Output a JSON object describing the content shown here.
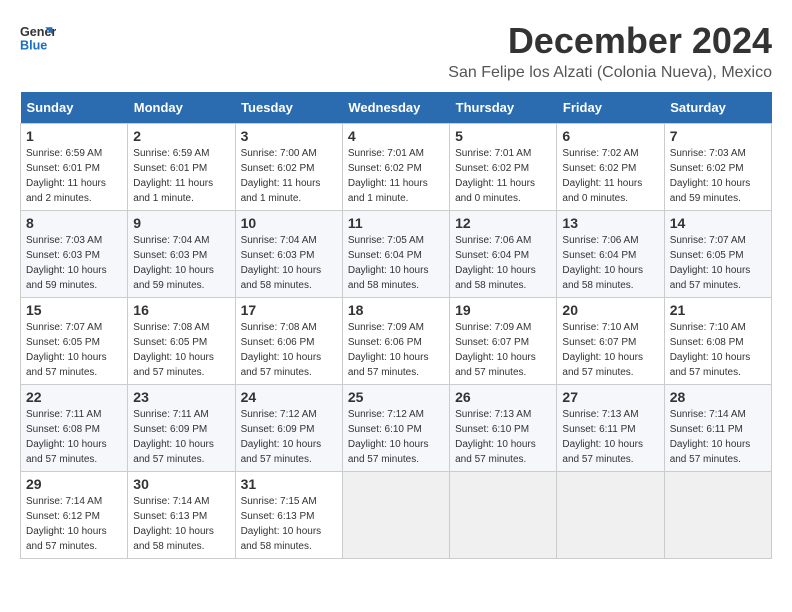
{
  "logo": {
    "line1": "General",
    "line2": "Blue"
  },
  "title": "December 2024",
  "location": "San Felipe los Alzati (Colonia Nueva), Mexico",
  "headers": [
    "Sunday",
    "Monday",
    "Tuesday",
    "Wednesday",
    "Thursday",
    "Friday",
    "Saturday"
  ],
  "weeks": [
    [
      {
        "day": "1",
        "info": "Sunrise: 6:59 AM\nSunset: 6:01 PM\nDaylight: 11 hours and 2 minutes."
      },
      {
        "day": "2",
        "info": "Sunrise: 6:59 AM\nSunset: 6:01 PM\nDaylight: 11 hours and 1 minute."
      },
      {
        "day": "3",
        "info": "Sunrise: 7:00 AM\nSunset: 6:02 PM\nDaylight: 11 hours and 1 minute."
      },
      {
        "day": "4",
        "info": "Sunrise: 7:01 AM\nSunset: 6:02 PM\nDaylight: 11 hours and 1 minute."
      },
      {
        "day": "5",
        "info": "Sunrise: 7:01 AM\nSunset: 6:02 PM\nDaylight: 11 hours and 0 minutes."
      },
      {
        "day": "6",
        "info": "Sunrise: 7:02 AM\nSunset: 6:02 PM\nDaylight: 11 hours and 0 minutes."
      },
      {
        "day": "7",
        "info": "Sunrise: 7:03 AM\nSunset: 6:02 PM\nDaylight: 10 hours and 59 minutes."
      }
    ],
    [
      {
        "day": "8",
        "info": "Sunrise: 7:03 AM\nSunset: 6:03 PM\nDaylight: 10 hours and 59 minutes."
      },
      {
        "day": "9",
        "info": "Sunrise: 7:04 AM\nSunset: 6:03 PM\nDaylight: 10 hours and 59 minutes."
      },
      {
        "day": "10",
        "info": "Sunrise: 7:04 AM\nSunset: 6:03 PM\nDaylight: 10 hours and 58 minutes."
      },
      {
        "day": "11",
        "info": "Sunrise: 7:05 AM\nSunset: 6:04 PM\nDaylight: 10 hours and 58 minutes."
      },
      {
        "day": "12",
        "info": "Sunrise: 7:06 AM\nSunset: 6:04 PM\nDaylight: 10 hours and 58 minutes."
      },
      {
        "day": "13",
        "info": "Sunrise: 7:06 AM\nSunset: 6:04 PM\nDaylight: 10 hours and 58 minutes."
      },
      {
        "day": "14",
        "info": "Sunrise: 7:07 AM\nSunset: 6:05 PM\nDaylight: 10 hours and 57 minutes."
      }
    ],
    [
      {
        "day": "15",
        "info": "Sunrise: 7:07 AM\nSunset: 6:05 PM\nDaylight: 10 hours and 57 minutes."
      },
      {
        "day": "16",
        "info": "Sunrise: 7:08 AM\nSunset: 6:05 PM\nDaylight: 10 hours and 57 minutes."
      },
      {
        "day": "17",
        "info": "Sunrise: 7:08 AM\nSunset: 6:06 PM\nDaylight: 10 hours and 57 minutes."
      },
      {
        "day": "18",
        "info": "Sunrise: 7:09 AM\nSunset: 6:06 PM\nDaylight: 10 hours and 57 minutes."
      },
      {
        "day": "19",
        "info": "Sunrise: 7:09 AM\nSunset: 6:07 PM\nDaylight: 10 hours and 57 minutes."
      },
      {
        "day": "20",
        "info": "Sunrise: 7:10 AM\nSunset: 6:07 PM\nDaylight: 10 hours and 57 minutes."
      },
      {
        "day": "21",
        "info": "Sunrise: 7:10 AM\nSunset: 6:08 PM\nDaylight: 10 hours and 57 minutes."
      }
    ],
    [
      {
        "day": "22",
        "info": "Sunrise: 7:11 AM\nSunset: 6:08 PM\nDaylight: 10 hours and 57 minutes."
      },
      {
        "day": "23",
        "info": "Sunrise: 7:11 AM\nSunset: 6:09 PM\nDaylight: 10 hours and 57 minutes."
      },
      {
        "day": "24",
        "info": "Sunrise: 7:12 AM\nSunset: 6:09 PM\nDaylight: 10 hours and 57 minutes."
      },
      {
        "day": "25",
        "info": "Sunrise: 7:12 AM\nSunset: 6:10 PM\nDaylight: 10 hours and 57 minutes."
      },
      {
        "day": "26",
        "info": "Sunrise: 7:13 AM\nSunset: 6:10 PM\nDaylight: 10 hours and 57 minutes."
      },
      {
        "day": "27",
        "info": "Sunrise: 7:13 AM\nSunset: 6:11 PM\nDaylight: 10 hours and 57 minutes."
      },
      {
        "day": "28",
        "info": "Sunrise: 7:14 AM\nSunset: 6:11 PM\nDaylight: 10 hours and 57 minutes."
      }
    ],
    [
      {
        "day": "29",
        "info": "Sunrise: 7:14 AM\nSunset: 6:12 PM\nDaylight: 10 hours and 57 minutes."
      },
      {
        "day": "30",
        "info": "Sunrise: 7:14 AM\nSunset: 6:13 PM\nDaylight: 10 hours and 58 minutes."
      },
      {
        "day": "31",
        "info": "Sunrise: 7:15 AM\nSunset: 6:13 PM\nDaylight: 10 hours and 58 minutes."
      },
      null,
      null,
      null,
      null
    ]
  ]
}
